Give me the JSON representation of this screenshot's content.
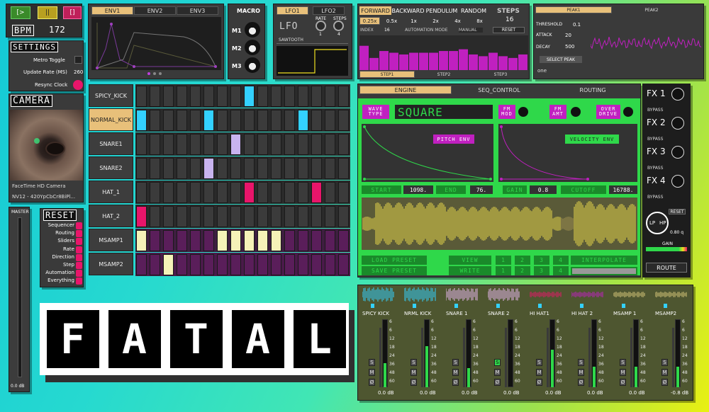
{
  "transport": {
    "play": "[>",
    "pause": "||",
    "stop": "[]",
    "bpm_label": "BPM",
    "bpm_value": "172"
  },
  "settings": {
    "title": "SETTINGS",
    "metro": "Metro Toggle",
    "update_rate": "Update Rate (MS)",
    "update_rate_value": "260",
    "resync": "Resync Clock"
  },
  "camera": {
    "title": "CAMERA",
    "device": "FaceTime HD Camera",
    "format": "NV12 - 420YpCbCr8BiPl..."
  },
  "master": {
    "label": "MASTER",
    "db": "0.0 dB"
  },
  "reset": {
    "title": "RESET",
    "items": [
      "Sequencer",
      "Routing",
      "Sliders",
      "Rate",
      "Direction",
      "Step",
      "Automation",
      "Everything"
    ]
  },
  "logo": [
    "F",
    "A",
    "T",
    "A",
    "L"
  ],
  "env": {
    "tabs": [
      "ENV1",
      "ENV2",
      "ENV3"
    ]
  },
  "macro": {
    "title": "MACRO",
    "items": [
      "M1",
      "M2",
      "M3"
    ]
  },
  "lfo": {
    "tabs": [
      "LFO1",
      "LFO2"
    ],
    "logo": "LFO",
    "rate": "RATE",
    "rate_val": "1",
    "steps": "STEPS",
    "steps_val": "4",
    "wave": "SAWTOOTH"
  },
  "seq": {
    "directions": [
      "FORWARD",
      "BACKWARD",
      "PENDULUM",
      "RANDOM"
    ],
    "steps_label": "STEPS",
    "steps_value": "16",
    "speeds": [
      "0.25x",
      "0.5x",
      "1x",
      "2x",
      "4x",
      "8x"
    ],
    "index_label": "INDEX",
    "index_value": "16",
    "auto_label": "AUTOMATION MODE",
    "auto_value": "MANUAL",
    "reset": "RESET",
    "step_tabs": [
      "STEP1",
      "STEP2",
      "STEP3"
    ],
    "bars": [
      0.7,
      0.35,
      0.55,
      0.5,
      0.45,
      0.5,
      0.5,
      0.5,
      0.55,
      0.55,
      0.6,
      0.45,
      0.4,
      0.5,
      0.4,
      0.35,
      0.45
    ]
  },
  "peak": {
    "tabs": [
      "PEAK1",
      "PEAK2"
    ],
    "threshold": "THRESHOLD",
    "threshold_val": "0.1",
    "attack": "ATTACK",
    "attack_val": "20",
    "decay": "DECAY",
    "decay_val": "500",
    "select": "SELECT PEAK",
    "dropdown": "one"
  },
  "grid": {
    "rows": [
      {
        "name": "SPICY_KICK",
        "cells": [
          0,
          0,
          0,
          0,
          0,
          0,
          0,
          0,
          "#33d1ff",
          0,
          0,
          0,
          0,
          0,
          0,
          0
        ]
      },
      {
        "name": "NORMAL_KICK",
        "highlight": true,
        "cells": [
          "#33d1ff",
          0,
          0,
          0,
          0,
          "#33d1ff",
          0,
          0,
          0,
          0,
          0,
          0,
          "#33d1ff",
          0,
          0,
          0
        ]
      },
      {
        "name": "SNARE1",
        "cells": [
          0,
          0,
          0,
          0,
          0,
          0,
          0,
          "#c8b3ef",
          0,
          0,
          0,
          0,
          0,
          0,
          0,
          0
        ]
      },
      {
        "name": "SNARE2",
        "cells": [
          0,
          0,
          0,
          0,
          0,
          "#c8b3ef",
          0,
          0,
          0,
          0,
          0,
          0,
          0,
          0,
          0,
          0
        ]
      },
      {
        "name": "HAT_1",
        "cells": [
          0,
          0,
          0,
          0,
          0,
          0,
          0,
          0,
          "#e8156a",
          0,
          0,
          0,
          0,
          "#e8156a",
          0,
          0
        ]
      },
      {
        "name": "HAT_2",
        "cells": [
          "#e8156a",
          0,
          0,
          0,
          0,
          0,
          0,
          0,
          0,
          0,
          0,
          0,
          0,
          0,
          0,
          0
        ]
      },
      {
        "name": "MSAMP1",
        "cells": [
          "#f5f2b8",
          0,
          0,
          0,
          0,
          0,
          "#f5f2b8",
          "#f5f2b8",
          "#f5f2b8",
          "#f5f2b8",
          "#f5f2b8",
          0,
          0,
          0,
          0,
          0
        ]
      },
      {
        "name": "MSAMP2",
        "cells": [
          0,
          0,
          "#f5f2b8",
          0,
          0,
          0,
          0,
          0,
          0,
          0,
          0,
          0,
          0,
          0,
          0,
          0
        ]
      }
    ]
  },
  "engine": {
    "tabs": [
      "ENGINE",
      "SEQ_CONTROL",
      "ROUTING"
    ],
    "wave_type": "WAVE TYPE",
    "wave": "SQUARE",
    "fm_mod": "FM MOD",
    "fm_amt": "FM AMT",
    "overdrive": "OVER DRIVE",
    "pitch_env": "PITCH ENV",
    "velocity_env": "VELOCITY ENV",
    "start": "START",
    "start_val": "1098.",
    "end": "END",
    "end_val": "76.",
    "gain": "GAIN",
    "gain_val": "0.8",
    "cutoff": "CUTOFF",
    "cutoff_val": "16788.",
    "load": "LOAD PRESET",
    "save": "SAVE PRESET",
    "view": "VIEW",
    "write": "WRITE",
    "slots": [
      "1",
      "2",
      "3",
      "4"
    ],
    "interpolate": "INTERPOLATE"
  },
  "fx": {
    "items": [
      {
        "label": "FX 1",
        "mode": "BYPASS"
      },
      {
        "label": "FX 2",
        "mode": "BYPASS"
      },
      {
        "label": "FX 3",
        "mode": "BYPASS"
      },
      {
        "label": "FX 4",
        "mode": "BYPASS"
      }
    ],
    "reset": "RESET",
    "lp": "LP",
    "hp": "HP",
    "q": "0.80 q",
    "gain": "GAIN",
    "route": "ROUTE"
  },
  "mixer": {
    "scale": [
      "6",
      "6",
      "12",
      "18",
      "24",
      "36",
      "48",
      "60"
    ],
    "channels": [
      {
        "name": "SPICY KICK",
        "db": "0.0 dB",
        "level": 0.35,
        "wave": "#33d1ff"
      },
      {
        "name": "NRML KICK",
        "db": "0.0 dB",
        "level": 0.6,
        "wave": "#33d1ff"
      },
      {
        "name": "SNARE 1",
        "db": "0.0 dB",
        "level": 0.28,
        "wave": "#e8b8f0"
      },
      {
        "name": "SNARE 2",
        "db": "0.0 dB",
        "level": 0.0,
        "wave": "#e8b8f0"
      },
      {
        "name": "HI HAT1",
        "db": "0.0 dB",
        "level": 0.55,
        "wave": "#e8156a"
      },
      {
        "name": "HI HAT 2",
        "db": "0.0 dB",
        "level": 0.3,
        "wave": "#c020c0"
      },
      {
        "name": "MSAMP 1",
        "db": "0.0 dB",
        "level": 0.3,
        "wave": "#d8c87a"
      },
      {
        "name": "MSAMP2",
        "db": "-0.8 dB",
        "level": 0.3,
        "wave": "#d8c87a"
      }
    ],
    "s": "S",
    "m": "M",
    "phase": "Ø"
  }
}
